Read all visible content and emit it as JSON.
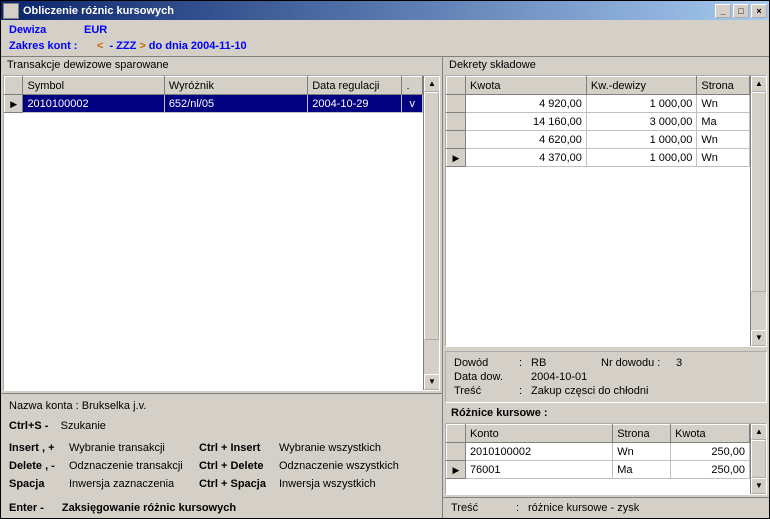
{
  "window": {
    "title": "Obliczenie różnic kursowych"
  },
  "header": {
    "currency_label": "Dewiza",
    "currency_value": "EUR",
    "range_label": "Zakres kont :",
    "range_value": "-  ZZZ",
    "until_label": "do dnia 2004-11-10"
  },
  "left": {
    "section_label": "Transakcje dewizowe sparowane",
    "columns": {
      "symbol": "Symbol",
      "wyroznik": "Wyróżnik",
      "data_regulacji": "Data regulacji",
      "flag": "."
    },
    "rows": [
      {
        "symbol": "2010100002",
        "wyroznik": "652/nl/05",
        "data": "2004-10-29",
        "flag": "v"
      }
    ]
  },
  "right": {
    "section_label": "Dekrety składowe",
    "columns": {
      "kwota": "Kwota",
      "kw_dewizy": "Kw.-dewizy",
      "strona": "Strona"
    },
    "rows": [
      {
        "kwota": "4 920,00",
        "kw_dewizy": "1 000,00",
        "strona": "Wn"
      },
      {
        "kwota": "14 160,00",
        "kw_dewizy": "3 000,00",
        "strona": "Ma"
      },
      {
        "kwota": "4 620,00",
        "kw_dewizy": "1 000,00",
        "strona": "Wn"
      },
      {
        "kwota": "4 370,00",
        "kw_dewizy": "1 000,00",
        "strona": "Wn"
      }
    ]
  },
  "account": {
    "label": "Nazwa konta : Brukselka j.v.",
    "ctrl_s": {
      "key": "Ctrl+S -",
      "desc": "Szukanie"
    },
    "hotkeys": [
      {
        "k1": "Insert , +",
        "d1": "Wybranie transakcji",
        "k2": "Ctrl + Insert",
        "d2": "Wybranie wszystkich"
      },
      {
        "k1": "Delete , -",
        "d1": "Odznaczenie transakcji",
        "k2": "Ctrl + Delete",
        "d2": "Odznaczenie wszystkich"
      },
      {
        "k1": "Spacja",
        "d1": "Inwersja zaznaczenia",
        "k2": "Ctrl + Spacja",
        "d2": "Inwersja wszystkich"
      }
    ],
    "enter": {
      "key": "Enter -",
      "desc": "Zaksięgowanie różnic kursowych"
    }
  },
  "meta": {
    "dowod_label": "Dowód",
    "dowod_value": "RB",
    "nr_dowodu_label": "Nr dowodu :",
    "nr_dowodu_value": "3",
    "data_label": "Data dow.",
    "data_value": "2004-10-01",
    "tresc_label": "Treść",
    "tresc_value": "Zakup częsci do chłodni"
  },
  "diff": {
    "label": "Różnice kursowe :",
    "columns": {
      "konto": "Konto",
      "strona": "Strona",
      "kwota": "Kwota"
    },
    "rows": [
      {
        "konto": "2010100002",
        "strona": "Wn",
        "kwota": "250,00"
      },
      {
        "konto": "76001",
        "strona": "Ma",
        "kwota": "250,00"
      }
    ]
  },
  "footer": {
    "tresc_label": "Treść",
    "tresc_value": "różnice kursowe - zysk"
  }
}
